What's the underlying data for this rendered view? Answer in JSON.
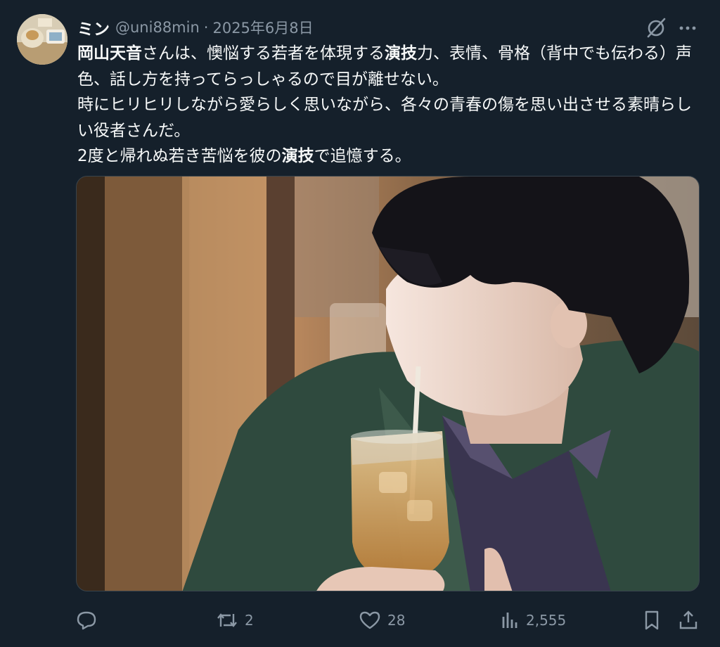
{
  "tweet": {
    "display_name": "ミン",
    "handle": "@uni88min",
    "separator": "·",
    "date": "2025年6月8日",
    "body": {
      "line1_bold": "岡山天音",
      "line1_a": "さんは、懊悩する若者を体現する",
      "line1_bold2": "演技",
      "line1_b": "力、表情、骨格（背中でも伝わる）声色、話し方を持ってらっしゃるので目が離せない。",
      "line2": "時にヒリヒリしながら愛らしく思いながら、各々の青春の傷を思い出させる素晴らしい役者さんだ。",
      "line3_a": "2度と帰れぬ若き苦悩を彼の",
      "line3_bold": "演技",
      "line3_b": "で追憶する。"
    },
    "icons": {
      "grok": "grok-icon",
      "more": "more-icon",
      "reply": "reply-icon",
      "retweet": "retweet-icon",
      "like": "like-icon",
      "views": "views-icon",
      "bookmark": "bookmark-icon",
      "share": "share-icon"
    },
    "stats": {
      "retweets": "2",
      "likes": "28",
      "views": "2,555"
    }
  },
  "colors": {
    "background": "#15202b",
    "text": "#f7f9f9",
    "secondary": "#8b98a5",
    "border": "#38444d"
  }
}
